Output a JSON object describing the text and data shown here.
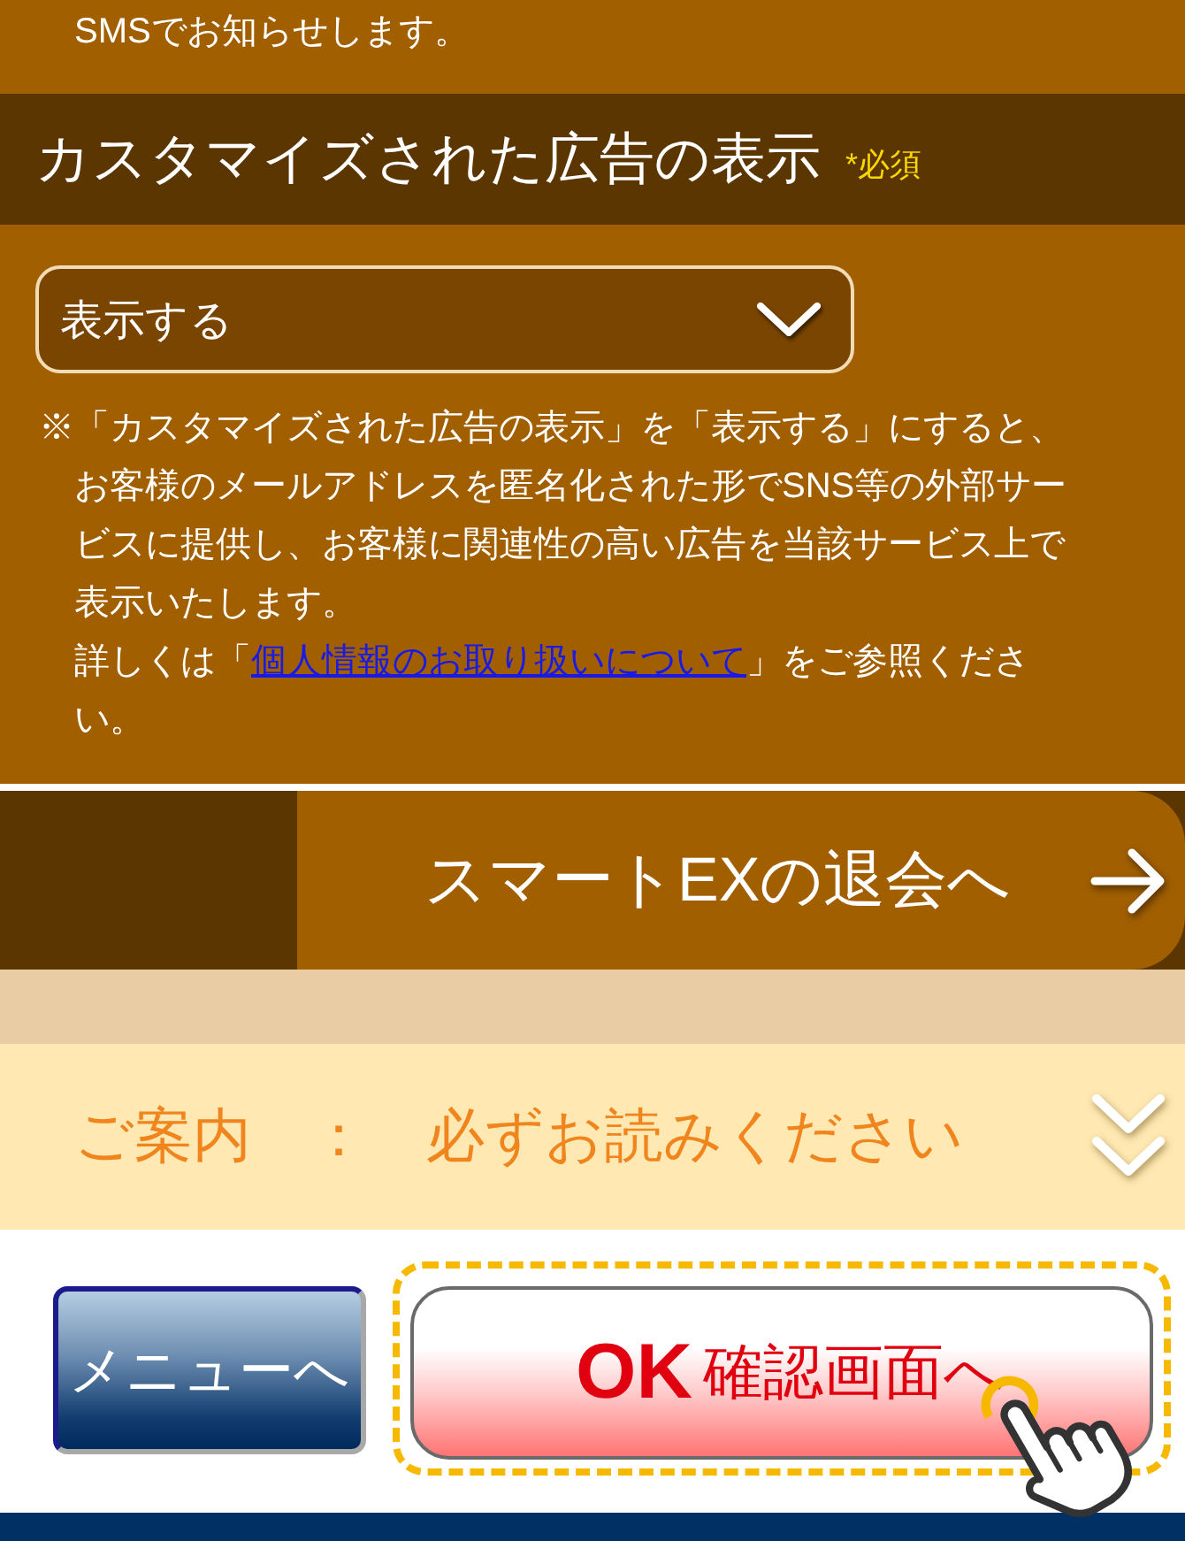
{
  "notice": {
    "text": "SMSでお知らせします。"
  },
  "section": {
    "title": "カスタマイズされた広告の表示",
    "required_label": "*必須"
  },
  "select": {
    "value": "表示する"
  },
  "note": {
    "lines": [
      "※「カスタマイズされた広告の表示」を「表示する」にすると、",
      "お客様のメールアドレスを匿名化された形でSNS等の外部サー",
      "ビスに提供し、お客様に関連性の高い広告を当該サービス上で",
      "表示いたします。"
    ],
    "details": {
      "before": "詳しくは「",
      "link": "個人情報のお取り扱いについて",
      "after": "」をご参照ください。"
    }
  },
  "withdraw_button": {
    "label": "スマートEXの退会へ"
  },
  "guide": {
    "text": "ご案内　：　必ずお読みください",
    "expanded": false
  },
  "buttons": [
    {
      "kind": "menu",
      "label": "メニューへ",
      "highlighted": false
    },
    {
      "kind": "confirm",
      "emphasis": "OK",
      "label": "確認画面へ",
      "highlighted": true
    }
  ]
}
